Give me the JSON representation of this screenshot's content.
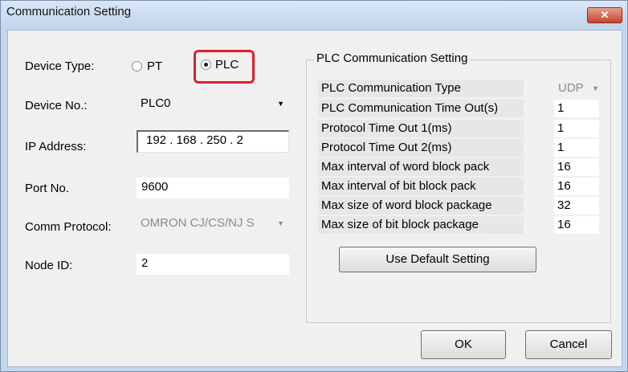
{
  "window": {
    "title": "Communication Setting",
    "close_glyph": "✕"
  },
  "device_type": {
    "label": "Device Type:",
    "options": [
      "PT",
      "PLC"
    ],
    "selected": "PLC"
  },
  "device_no": {
    "label": "Device No.:",
    "value": "PLC0"
  },
  "ip_address": {
    "label": "IP Address:",
    "octets": [
      "192",
      "168",
      "250",
      "2"
    ]
  },
  "port_no": {
    "label": "Port No.",
    "value": "9600"
  },
  "comm_protocol": {
    "label": "Comm Protocol:",
    "value": "OMRON CJ/CS/NJ S"
  },
  "node_id": {
    "label": "Node ID:",
    "value": "2"
  },
  "plc_group": {
    "title": "PLC Communication Setting",
    "rows": [
      {
        "label": "PLC Communication Type",
        "value": "UDP"
      },
      {
        "label": "PLC Communication Time Out(s)",
        "value": "1"
      },
      {
        "label": "Protocol Time Out 1(ms)",
        "value": "1"
      },
      {
        "label": "Protocol Time Out 2(ms)",
        "value": "1"
      },
      {
        "label": "Max interval of word block pack",
        "value": "16"
      },
      {
        "label": "Max interval of bit block pack",
        "value": "16"
      },
      {
        "label": "Max size of word block package",
        "value": "32"
      },
      {
        "label": "Max size of bit block package",
        "value": "16"
      }
    ],
    "default_button": "Use Default Setting"
  },
  "buttons": {
    "ok": "OK",
    "cancel": "Cancel"
  },
  "colors": {
    "highlight": "#e0202b",
    "frame": "#c4d6ec",
    "close": "#c6452c"
  }
}
